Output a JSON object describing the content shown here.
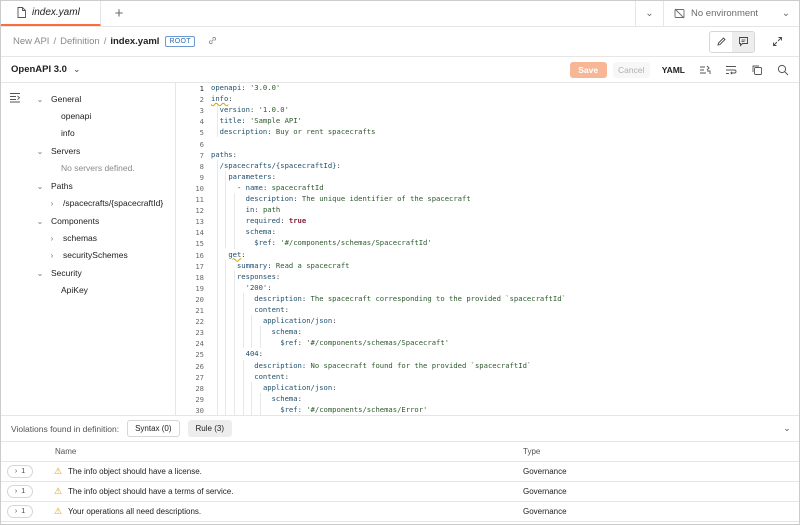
{
  "tabs": {
    "active_tab": "index.yaml",
    "environment": "No environment"
  },
  "breadcrumb": {
    "items": [
      "New API",
      "Definition"
    ],
    "current": "index.yaml",
    "badge": "ROOT"
  },
  "toolbar": {
    "spec_label": "OpenAPI 3.0",
    "save_label": "Save",
    "cancel_label": "Cancel",
    "format_label": "YAML"
  },
  "sidebar": {
    "sections": [
      {
        "label": "General",
        "children": [
          "openapi",
          "info"
        ]
      },
      {
        "label": "Servers",
        "empty_text": "No servers defined."
      },
      {
        "label": "Paths",
        "children": [
          "/spacecrafts/{spacecraftId}"
        ]
      },
      {
        "label": "Components",
        "children": [
          "schemas",
          "securitySchemes"
        ]
      },
      {
        "label": "Security",
        "children": [
          "ApiKey"
        ]
      }
    ]
  },
  "editor": {
    "current_line": 1,
    "lines": [
      "openapi: '3.0.0'",
      "info:",
      "  version: '1.0.0'",
      "  title: 'Sample API'",
      "  description: Buy or rent spacecrafts",
      "",
      "paths:",
      "  /spacecrafts/{spacecraftId}:",
      "    parameters:",
      "      - name: spacecraftId",
      "        description: The unique identifier of the spacecraft",
      "        in: path",
      "        required: true",
      "        schema:",
      "          $ref: '#/components/schemas/SpacecraftId'",
      "    get:",
      "      summary: Read a spacecraft",
      "      responses:",
      "        '200':",
      "          description: The spacecraft corresponding to the provided `spacecraftId`",
      "          content:",
      "            application/json:",
      "              schema:",
      "                $ref: '#/components/schemas/Spacecraft'",
      "        404:",
      "          description: No spacecraft found for the provided `spacecraftId`",
      "          content:",
      "            application/json:",
      "              schema:",
      "                $ref: '#/components/schemas/Error'"
    ]
  },
  "violations": {
    "title": "Violations found in definition:",
    "syntax_label": "Syntax (0)",
    "rule_label": "Rule (3)",
    "columns": {
      "name": "Name",
      "type": "Type"
    },
    "rows": [
      {
        "count": "1",
        "message": "The info object should have a license.",
        "type": "Governance"
      },
      {
        "count": "1",
        "message": "The info object should have a terms of service.",
        "type": "Governance"
      },
      {
        "count": "1",
        "message": "Your operations all need descriptions.",
        "type": "Governance"
      }
    ]
  },
  "colors": {
    "accent": "#ff6c37",
    "save_button": "#f7b797",
    "warning": "#d99a00"
  }
}
